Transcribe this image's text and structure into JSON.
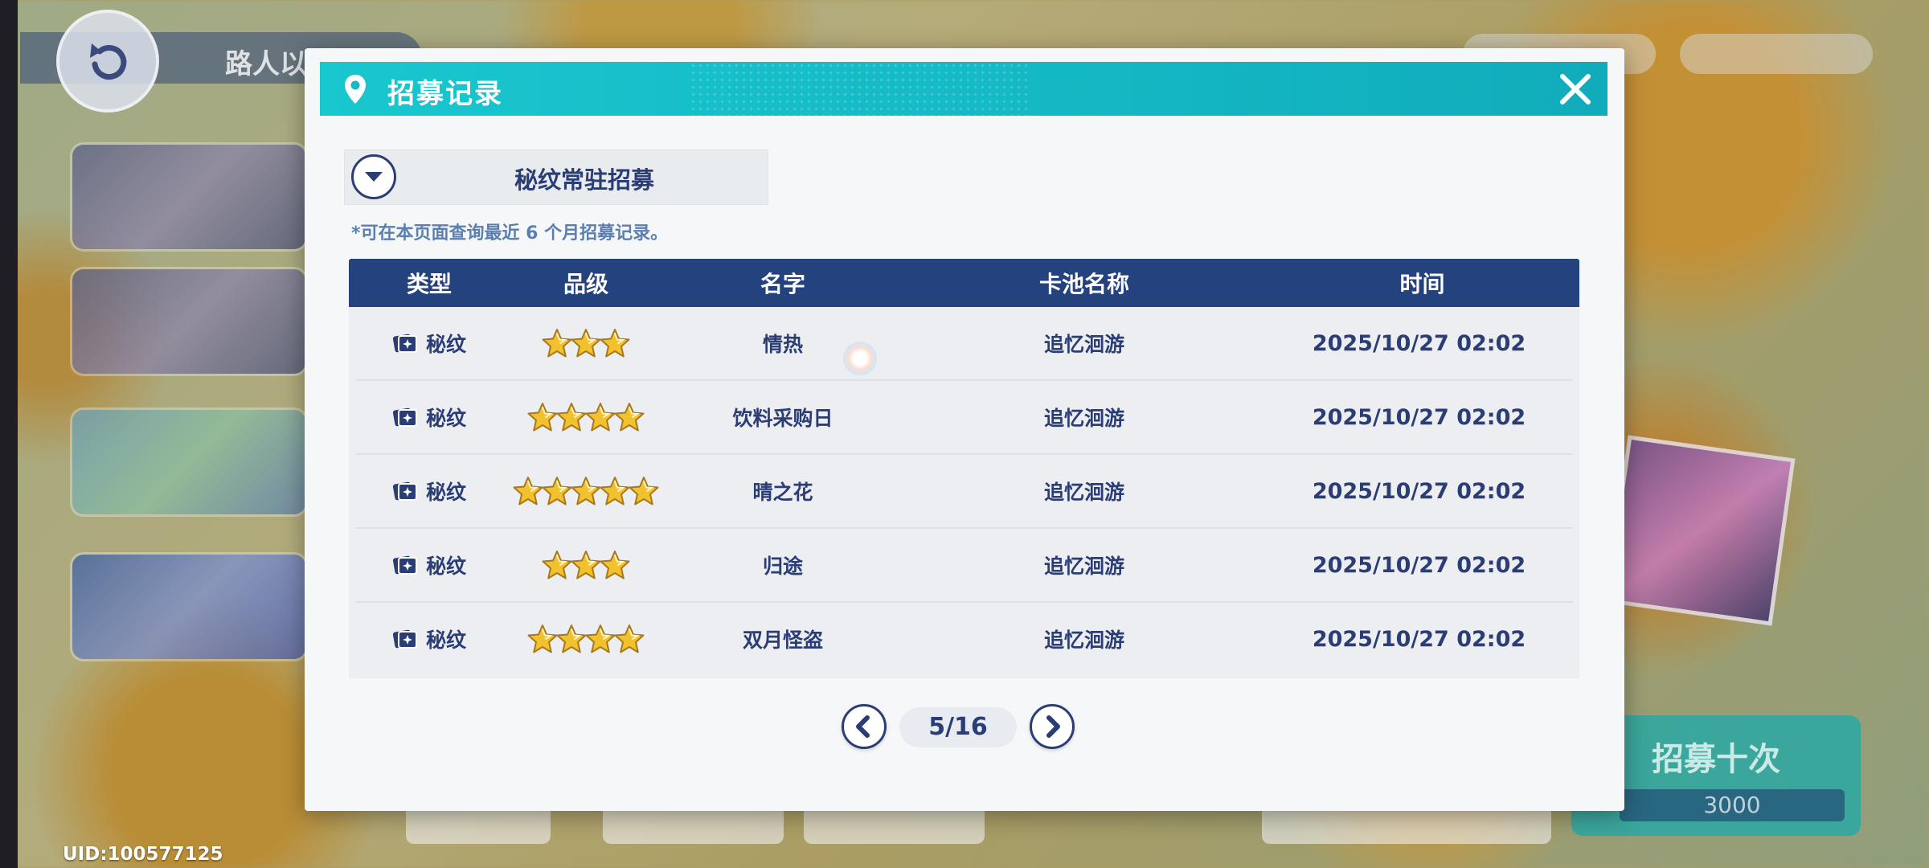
{
  "background": {
    "location_text": "路人以外",
    "recruit_button": {
      "title": "招募十次",
      "cost": "3000"
    },
    "uid": "UID:100577125"
  },
  "modal": {
    "title": "招募记录",
    "pool_selector": {
      "selected": "秘纹常驻招募"
    },
    "notice": "*可在本页面查询最近 6 个月招募记录。",
    "table": {
      "headers": [
        "类型",
        "品级",
        "名字",
        "卡池名称",
        "时间"
      ],
      "rows": [
        {
          "type": "秘纹",
          "stars": 3,
          "name": "情热",
          "pool": "追忆洄游",
          "time": "2025/10/27 02:02"
        },
        {
          "type": "秘纹",
          "stars": 4,
          "name": "饮料采购日",
          "pool": "追忆洄游",
          "time": "2025/10/27 02:02"
        },
        {
          "type": "秘纹",
          "stars": 5,
          "name": "晴之花",
          "pool": "追忆洄游",
          "time": "2025/10/27 02:02"
        },
        {
          "type": "秘纹",
          "stars": 3,
          "name": "归途",
          "pool": "追忆洄游",
          "time": "2025/10/27 02:02"
        },
        {
          "type": "秘纹",
          "stars": 4,
          "name": "双月怪盗",
          "pool": "追忆洄游",
          "time": "2025/10/27 02:02"
        }
      ]
    },
    "pagination": {
      "text": "5/16",
      "current": 5,
      "total": 16
    }
  },
  "colors": {
    "header_teal": "#14b9c4",
    "table_header_navy": "#24427e",
    "text_navy": "#2b3d75",
    "notice_blue": "#5a7fb0",
    "star_gold": "#f2c12e"
  },
  "icons": {
    "header": "location-pin-icon",
    "close": "close-icon",
    "dropdown": "chevron-down-icon",
    "type": "card-sparkle-icon",
    "grade": "star-icon",
    "prev": "chevron-left-icon",
    "next": "chevron-right-icon"
  }
}
